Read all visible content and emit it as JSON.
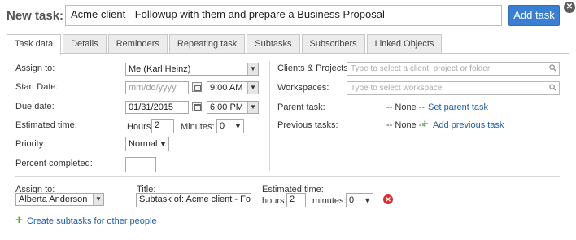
{
  "header": {
    "new_task_label": "New task:",
    "task_title_value": "Acme client - Followup with them and prepare a Business Proposal",
    "add_task_button": "Add task"
  },
  "tabs": [
    {
      "label": "Task data",
      "active": true
    },
    {
      "label": "Details"
    },
    {
      "label": "Reminders"
    },
    {
      "label": "Repeating task"
    },
    {
      "label": "Subtasks"
    },
    {
      "label": "Subscribers"
    },
    {
      "label": "Linked Objects"
    }
  ],
  "left": {
    "assign_to_label": "Assign to:",
    "assign_to_value": "Me (Karl Heinz)",
    "start_date_label": "Start Date:",
    "start_date_placeholder": "mm/dd/yyyy",
    "start_time_value": "9:00 AM",
    "due_date_label": "Due date:",
    "due_date_value": "01/31/2015",
    "due_time_value": "6:00 PM",
    "estimated_time_label": "Estimated time:",
    "hours_label": "Hours:",
    "hours_value": "2",
    "minutes_label": "Minutes:",
    "minutes_value": "0",
    "priority_label": "Priority:",
    "priority_value": "Normal",
    "percent_completed_label": "Percent completed:",
    "percent_completed_value": ""
  },
  "right": {
    "clients_projects_label": "Clients & Projects:",
    "clients_projects_placeholder": "Type to select a client, project or folder",
    "workspaces_label": "Workspaces:",
    "workspaces_placeholder": "Type to select workspace",
    "parent_task_label": "Parent task:",
    "parent_task_value": "-- None --",
    "set_parent_task_link": "Set parent task",
    "previous_tasks_label": "Previous tasks:",
    "previous_tasks_value": "-- None --",
    "add_previous_task_link": "Add previous task"
  },
  "subtask": {
    "assign_to_label": "Assign to:",
    "assign_to_value": "Alberta Anderson",
    "title_label": "Title:",
    "title_value": "Subtask of: Acme client - Followup",
    "estimated_time_label": "Estimated time:",
    "hours_label": "hours:",
    "hours_value": "2",
    "minutes_label": "minutes:",
    "minutes_value": "0",
    "create_subtasks_link": "Create subtasks for other people"
  },
  "icons": {
    "close": "close-icon",
    "calendar": "calendar-icon",
    "search": "search-icon",
    "add": "plus-icon",
    "remove": "remove-icon"
  },
  "colors": {
    "accent": "#3a7fd1",
    "link": "#1f5fa8",
    "add_green": "#4caf28",
    "remove_red": "#d9302f"
  }
}
